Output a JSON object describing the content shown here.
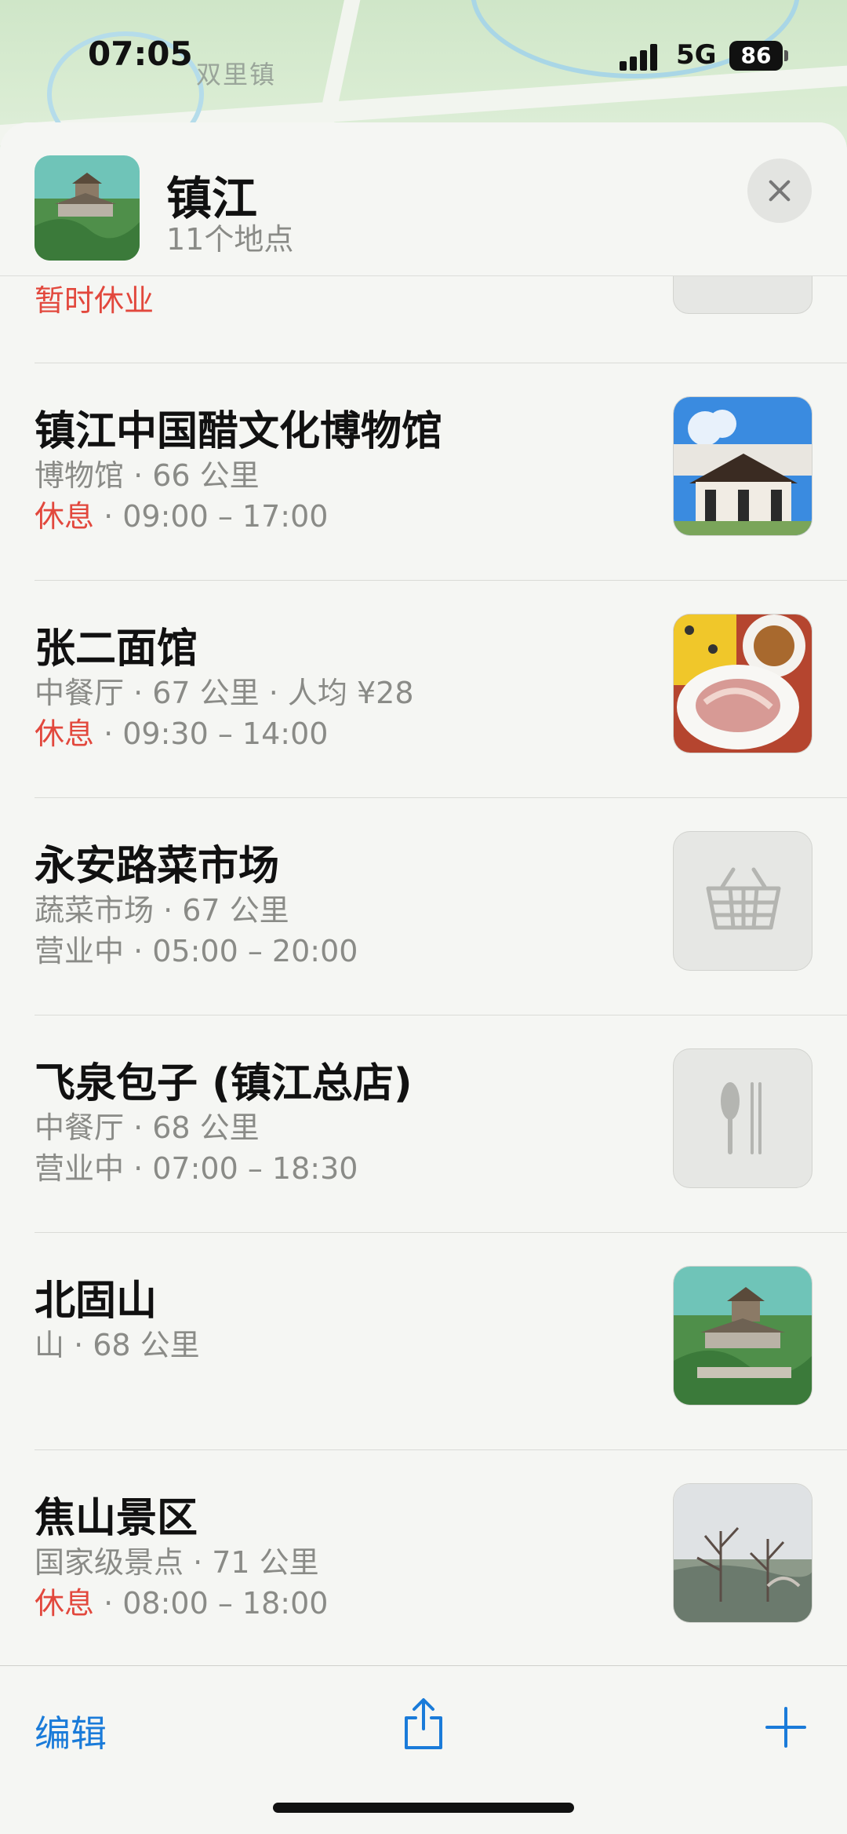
{
  "status_bar": {
    "time": "07:05",
    "network": "5G",
    "battery": "86"
  },
  "map": {
    "label": "双里镇"
  },
  "header": {
    "title": "镇江",
    "subtitle": "11个地点",
    "close_icon": "close-icon"
  },
  "partial_item": {
    "status": "暂时休业"
  },
  "items": [
    {
      "name": "镇江中国醋文化博物馆",
      "line1": "博物馆 · 66 公里",
      "status": "休息",
      "hours": " · 09:00 – 17:00",
      "thumb": "photo"
    },
    {
      "name": "张二面馆",
      "line1": "中餐厅 · 67 公里 · 人均 ¥28",
      "status": "休息",
      "hours": " · 09:30 – 14:00",
      "thumb": "photo"
    },
    {
      "name": "永安路菜市场",
      "line1": "蔬菜市场 · 67 公里",
      "status": "营业中",
      "hours": " · 05:00 – 20:00",
      "thumb": "basket-icon"
    },
    {
      "name": "飞泉包子 (镇江总店)",
      "line1": "中餐厅 · 68 公里",
      "status": "营业中",
      "hours": " · 07:00 – 18:30",
      "thumb": "fork-knife-icon"
    },
    {
      "name": "北固山",
      "line1": "山 · 68 公里",
      "status": "",
      "hours": "",
      "thumb": "photo"
    },
    {
      "name": "焦山景区",
      "line1": "国家级景点 · 71 公里",
      "status": "休息",
      "hours": " · 08:00 – 18:00",
      "thumb": "photo"
    }
  ],
  "toolbar": {
    "edit_label": "编辑",
    "share_icon": "share-icon",
    "add_icon": "plus-icon"
  },
  "colors": {
    "accent": "#1a7bd9",
    "closed": "#e2483d",
    "secondary": "#8a8b87"
  }
}
